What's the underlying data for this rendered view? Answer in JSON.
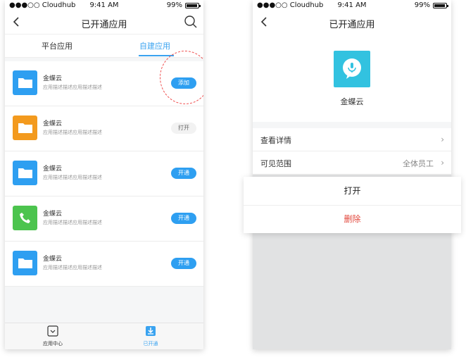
{
  "status": {
    "carrier": "●●●○○ Cloudhub",
    "time": "9:41 AM",
    "battery": "99%"
  },
  "left": {
    "title": "已开通应用",
    "tabs": [
      "平台应用",
      "自建应用"
    ],
    "items": [
      {
        "name": "金蝶云",
        "desc": "应用描述描述应用描述描述",
        "button": "添加",
        "icon_color": "#2e9ff1",
        "icon": "folder-icon"
      },
      {
        "name": "金蝶云",
        "desc": "应用描述描述应用描述描述",
        "button": "打开",
        "icon_color": "#f39a1e",
        "icon": "folder-icon"
      },
      {
        "name": "金蝶云",
        "desc": "应用描述描述应用描述描述",
        "button": "开通",
        "icon_color": "#2e9ff1",
        "icon": "folder-icon"
      },
      {
        "name": "金蝶云",
        "desc": "应用描述描述应用描述描述",
        "button": "开通",
        "icon_color": "#4cc44e",
        "icon": "phone-icon"
      },
      {
        "name": "金蝶云",
        "desc": "应用描述描述应用描述描述",
        "button": "开通",
        "icon_color": "#2e9ff1",
        "icon": "folder-icon"
      }
    ],
    "tabbar": [
      "应用中心",
      "已开通"
    ]
  },
  "right": {
    "title": "已开通应用",
    "app_name": "金蝶云",
    "rows": {
      "details": "查看详情",
      "scope_label": "可见范围",
      "scope_value": "全体员工"
    },
    "sheet": {
      "open": "打开",
      "delete": "删除"
    }
  }
}
